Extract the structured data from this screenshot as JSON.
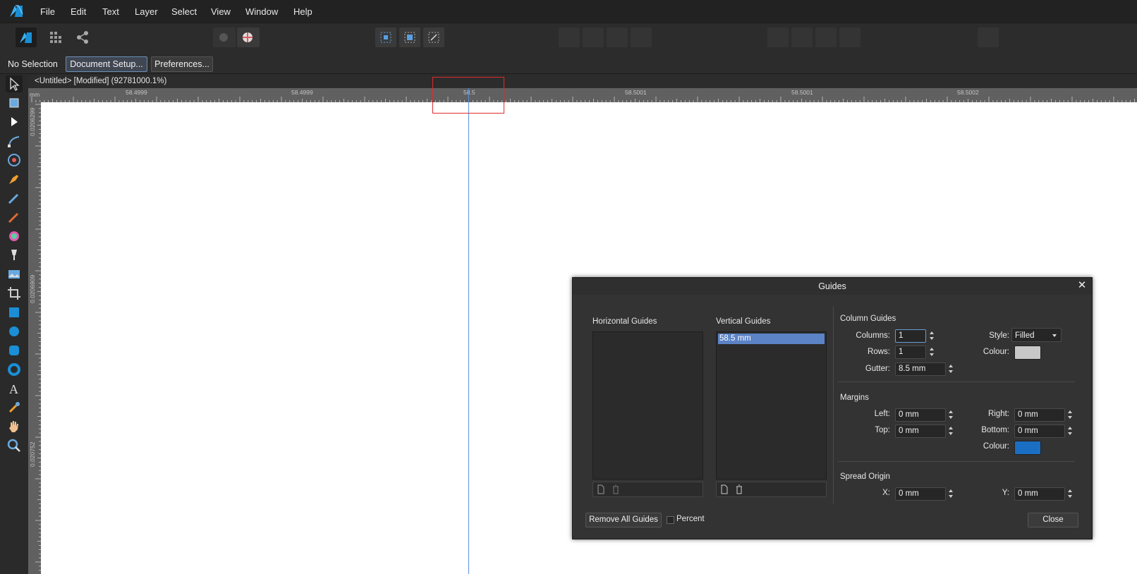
{
  "menubar": {
    "items": [
      "File",
      "Edit",
      "Text",
      "Layer",
      "Select",
      "View",
      "Window",
      "Help"
    ]
  },
  "toolbar": {
    "icons": [
      "designer-persona-icon",
      "pixel-persona-icon",
      "export-persona-icon",
      "flood-fill-icon",
      "colour-picker-icon",
      "snap-grid-icon",
      "snap-center-icon",
      "snap-bounds-icon",
      "boolean-add-icon",
      "boolean-subtract-icon",
      "boolean-intersect-icon",
      "boolean-xor-icon",
      "flip-horizontal-icon",
      "flip-vertical-icon",
      "rotate-left-icon",
      "rotate-right-icon",
      "align-icon"
    ]
  },
  "context": {
    "selection_label": "No Selection",
    "document_setup": "Document Setup...",
    "preferences": "Preferences..."
  },
  "document": {
    "title": "<Untitled> [Modified] (92781000.1%)"
  },
  "ruler": {
    "unit": "mm",
    "h_labels": [
      "58.4999",
      "58.4999",
      "58.5",
      "58.5001",
      "58.5001",
      "58.5002"
    ],
    "v_labels": [
      "0.0206299",
      "0.0206909",
      "0.020752"
    ]
  },
  "dialog": {
    "title": "Guides",
    "horizontal_guides_label": "Horizontal Guides",
    "vertical_guides_label": "Vertical Guides",
    "vertical_guides": [
      "58.5 mm"
    ],
    "column_guides": {
      "heading": "Column Guides",
      "columns_label": "Columns:",
      "columns_value": "1",
      "rows_label": "Rows:",
      "rows_value": "1",
      "gutter_label": "Gutter:",
      "gutter_value": "8.5 mm",
      "style_label": "Style:",
      "style_value": "Filled",
      "colour_label": "Colour:",
      "colour": "#c8c8c8"
    },
    "margins": {
      "heading": "Margins",
      "left_label": "Left:",
      "left_value": "0 mm",
      "top_label": "Top:",
      "top_value": "0 mm",
      "right_label": "Right:",
      "right_value": "0 mm",
      "bottom_label": "Bottom:",
      "bottom_value": "0 mm",
      "colour_label": "Colour:",
      "colour": "#1a6fc2"
    },
    "spread_origin": {
      "heading": "Spread Origin",
      "x_label": "X:",
      "x_value": "0 mm",
      "y_label": "Y:",
      "y_value": "0 mm"
    },
    "remove_all": "Remove All Guides",
    "percent": "Percent",
    "close": "Close"
  },
  "colors": {
    "guide_line": "#5b8fe0",
    "highlight_box": "#e02b2b",
    "brand": "#1fa3e8"
  }
}
